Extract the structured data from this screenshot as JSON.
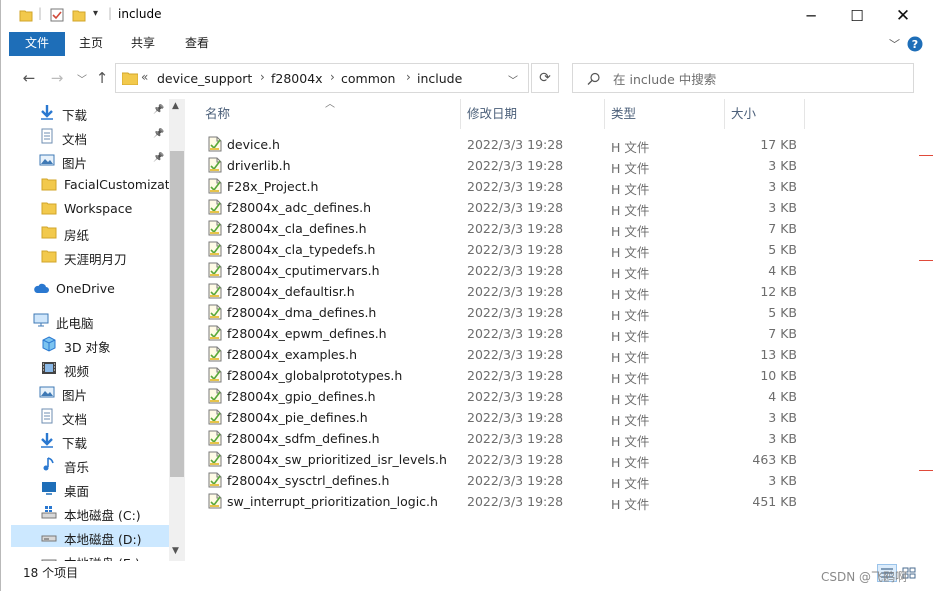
{
  "window": {
    "title": "include"
  },
  "ribbon": {
    "tabs": [
      "文件",
      "主页",
      "共享",
      "查看"
    ]
  },
  "address": {
    "overflow": "«",
    "crumbs": [
      "device_support",
      "f28004x",
      "common",
      "include"
    ]
  },
  "search": {
    "placeholder": "在 include 中搜索"
  },
  "nav_pane": {
    "items": [
      {
        "label": "下载",
        "icon": "download-arrow-icon",
        "pinned": true
      },
      {
        "label": "文档",
        "icon": "document-icon",
        "pinned": true
      },
      {
        "label": "图片",
        "icon": "picture-icon",
        "pinned": true
      },
      {
        "label": "FacialCustomization",
        "icon": "folder-icon",
        "pinned": false
      },
      {
        "label": "Workspace",
        "icon": "folder-icon",
        "pinned": false
      },
      {
        "label": "房纸",
        "icon": "folder-icon",
        "pinned": false
      },
      {
        "label": "天涯明月刀",
        "icon": "folder-icon",
        "pinned": false
      },
      {
        "label": "OneDrive",
        "icon": "cloud-icon",
        "pinned": false
      },
      {
        "label": "此电脑",
        "icon": "computer-icon",
        "pinned": false
      },
      {
        "label": "3D 对象",
        "icon": "cube-icon",
        "pinned": false
      },
      {
        "label": "视频",
        "icon": "video-icon",
        "pinned": false
      },
      {
        "label": "图片",
        "icon": "picture-icon",
        "pinned": false
      },
      {
        "label": "文档",
        "icon": "document-icon",
        "pinned": false
      },
      {
        "label": "下载",
        "icon": "download-arrow-icon",
        "pinned": false
      },
      {
        "label": "音乐",
        "icon": "music-note-icon",
        "pinned": false
      },
      {
        "label": "桌面",
        "icon": "desktop-icon",
        "pinned": false
      },
      {
        "label": "本地磁盘 (C:)",
        "icon": "windows-drive-icon",
        "pinned": false
      },
      {
        "label": "本地磁盘 (D:)",
        "icon": "drive-icon",
        "pinned": false,
        "selected": true
      },
      {
        "label": "本地磁盘 (E:)",
        "icon": "drive-icon",
        "pinned": false
      }
    ]
  },
  "columns": {
    "name": "名称",
    "date": "修改日期",
    "type": "类型",
    "size": "大小"
  },
  "files": [
    {
      "name": "device.h",
      "date": "2022/3/3 19:28",
      "type": "H 文件",
      "size": "17 KB"
    },
    {
      "name": "driverlib.h",
      "date": "2022/3/3 19:28",
      "type": "H 文件",
      "size": "3 KB"
    },
    {
      "name": "F28x_Project.h",
      "date": "2022/3/3 19:28",
      "type": "H 文件",
      "size": "3 KB"
    },
    {
      "name": "f28004x_adc_defines.h",
      "date": "2022/3/3 19:28",
      "type": "H 文件",
      "size": "3 KB"
    },
    {
      "name": "f28004x_cla_defines.h",
      "date": "2022/3/3 19:28",
      "type": "H 文件",
      "size": "7 KB"
    },
    {
      "name": "f28004x_cla_typedefs.h",
      "date": "2022/3/3 19:28",
      "type": "H 文件",
      "size": "5 KB"
    },
    {
      "name": "f28004x_cputimervars.h",
      "date": "2022/3/3 19:28",
      "type": "H 文件",
      "size": "4 KB"
    },
    {
      "name": "f28004x_defaultisr.h",
      "date": "2022/3/3 19:28",
      "type": "H 文件",
      "size": "12 KB"
    },
    {
      "name": "f28004x_dma_defines.h",
      "date": "2022/3/3 19:28",
      "type": "H 文件",
      "size": "5 KB"
    },
    {
      "name": "f28004x_epwm_defines.h",
      "date": "2022/3/3 19:28",
      "type": "H 文件",
      "size": "7 KB"
    },
    {
      "name": "f28004x_examples.h",
      "date": "2022/3/3 19:28",
      "type": "H 文件",
      "size": "13 KB"
    },
    {
      "name": "f28004x_globalprototypes.h",
      "date": "2022/3/3 19:28",
      "type": "H 文件",
      "size": "10 KB"
    },
    {
      "name": "f28004x_gpio_defines.h",
      "date": "2022/3/3 19:28",
      "type": "H 文件",
      "size": "4 KB"
    },
    {
      "name": "f28004x_pie_defines.h",
      "date": "2022/3/3 19:28",
      "type": "H 文件",
      "size": "3 KB"
    },
    {
      "name": "f28004x_sdfm_defines.h",
      "date": "2022/3/3 19:28",
      "type": "H 文件",
      "size": "3 KB"
    },
    {
      "name": "f28004x_sw_prioritized_isr_levels.h",
      "date": "2022/3/3 19:28",
      "type": "H 文件",
      "size": "463 KB"
    },
    {
      "name": "f28004x_sysctrl_defines.h",
      "date": "2022/3/3 19:28",
      "type": "H 文件",
      "size": "3 KB"
    },
    {
      "name": "sw_interrupt_prioritization_logic.h",
      "date": "2022/3/3 19:28",
      "type": "H 文件",
      "size": "451 KB"
    }
  ],
  "status": {
    "item_count": "18 个项目"
  },
  "watermark": "CSDN @飞鸥啊",
  "colors": {
    "accent": "#1e6eb8",
    "selection": "#cce8ff",
    "folder": "#f2c94c",
    "help": "#1e6eb8"
  }
}
